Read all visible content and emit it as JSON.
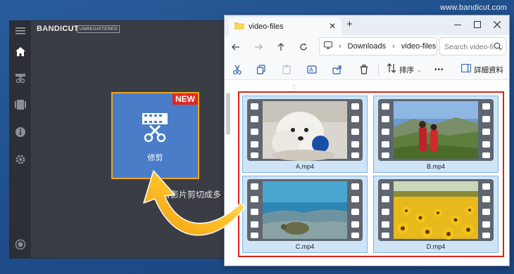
{
  "watermark": "www.bandicut.com",
  "bandicut": {
    "logo_bandi": "BANDI",
    "logo_cut": "CUT",
    "unregistered": "UNREGISTERED",
    "tile": {
      "new_badge": "NEW",
      "label": "修剪"
    },
    "description": "將影片剪切成多",
    "sidebar": [
      "menu-icon",
      "home-icon",
      "cut-icon",
      "film-icon",
      "info-icon",
      "gear-icon",
      "record-icon"
    ]
  },
  "explorer": {
    "tab_title": "video-files",
    "new_tab": "+",
    "breadcrumb": [
      "Downloads",
      "video-files"
    ],
    "search_placeholder": "Search video-files",
    "toolbar": {
      "sort_label": "排序",
      "more_label": "•••",
      "details_label": "詳細資料"
    },
    "files": [
      {
        "name": "A.mp4",
        "scene": "puppy"
      },
      {
        "name": "B.mp4",
        "scene": "hills"
      },
      {
        "name": "C.mp4",
        "scene": "underwater"
      },
      {
        "name": "D.mp4",
        "scene": "sunflowers"
      }
    ]
  },
  "colors": {
    "accent_orange": "#f0a419",
    "badge_red": "#e0281d",
    "tile_blue": "#4a7dc8",
    "selection_red": "#e0201c"
  }
}
